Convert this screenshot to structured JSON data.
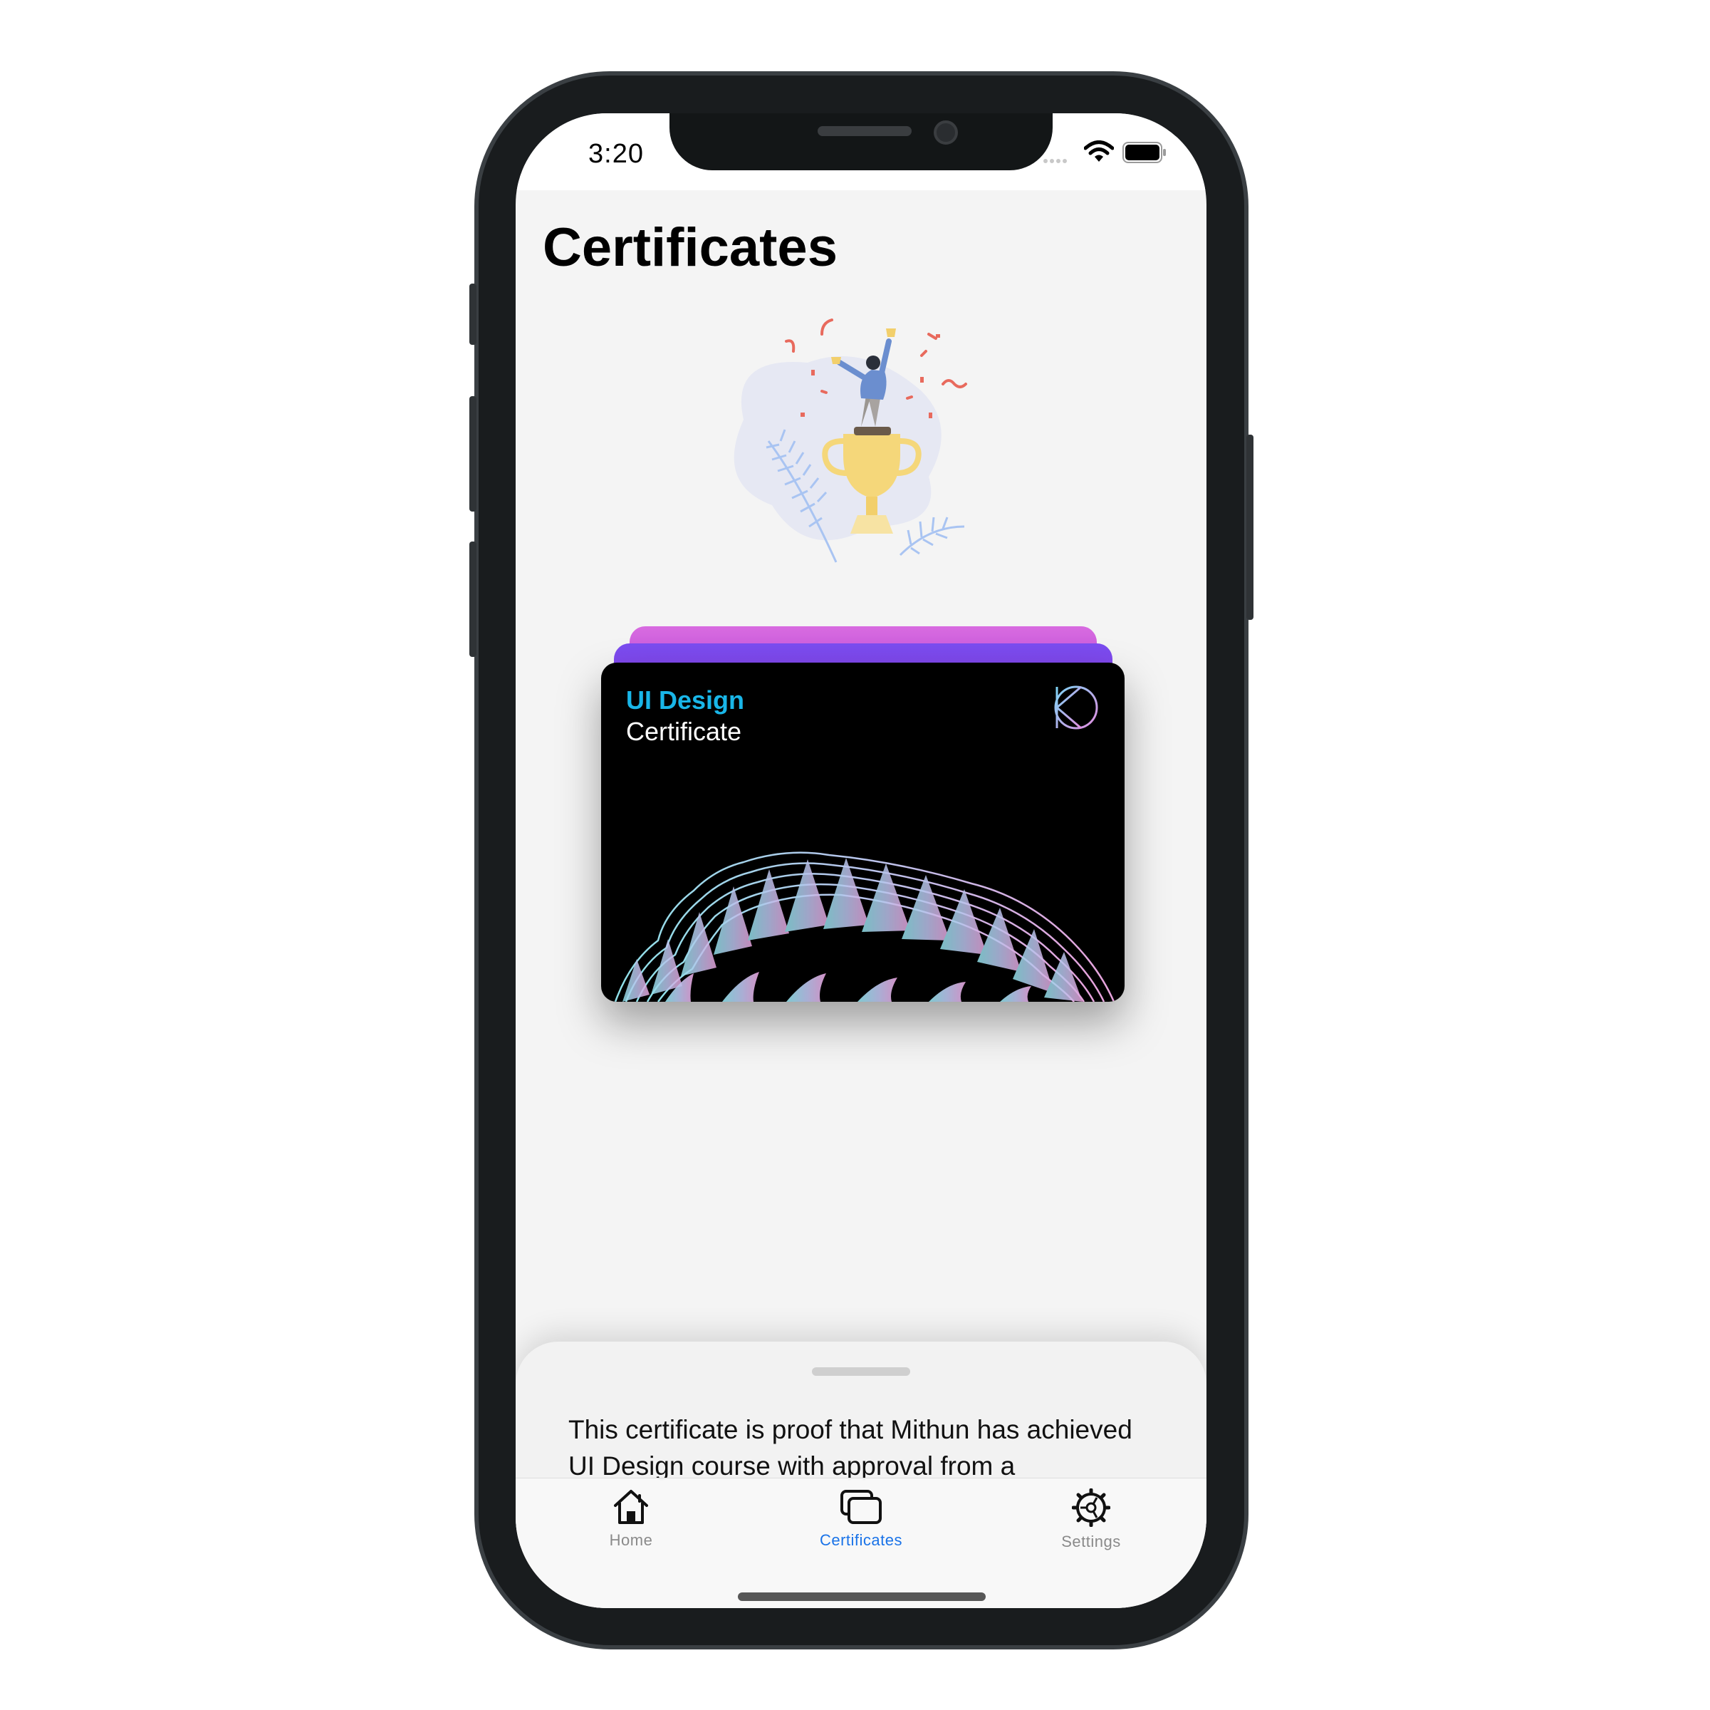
{
  "status_bar": {
    "time": "3:20"
  },
  "page": {
    "title": "Certificates"
  },
  "certificate_card": {
    "title": "UI Design",
    "subtitle": "Certificate",
    "colors": {
      "title": "#19b6e8",
      "back_card_1": "#d86be0",
      "back_card_2": "#7a4df0"
    }
  },
  "sheet": {
    "text": "This certificate is proof that Mithun has achieved UI Design course with approval from a"
  },
  "tab_bar": {
    "items": [
      {
        "label": "Home",
        "icon": "house-icon"
      },
      {
        "label": "Certificates",
        "icon": "rectangle-stack-icon",
        "active": true
      },
      {
        "label": "Settings",
        "icon": "gear-icon"
      }
    ],
    "active_color": "#1a73e8"
  }
}
